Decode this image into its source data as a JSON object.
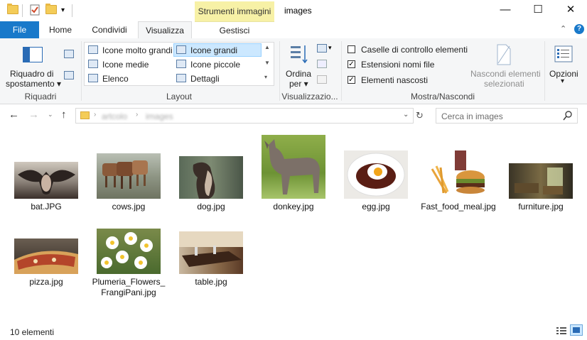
{
  "window": {
    "title": "images",
    "context_tab_group": "Strumenti immagini",
    "controls": {
      "minimize": "—",
      "maximize": "☐",
      "close": "✕"
    }
  },
  "tabs": {
    "file": "File",
    "home": "Home",
    "share": "Condividi",
    "view": "Visualizza",
    "manage": "Gestisci"
  },
  "ribbon": {
    "panes": {
      "nav_pane_line1": "Riquadro di",
      "nav_pane_line2": "spostamento ▾",
      "group_label": "Riquadri"
    },
    "layout": {
      "items": [
        "Icone molto grandi",
        "Icone grandi",
        "Icone medie",
        "Icone piccole",
        "Elenco",
        "Dettagli"
      ],
      "selected": "Icone grandi",
      "group_label": "Layout"
    },
    "current_view": {
      "sort_line1": "Ordina",
      "sort_line2": "per ▾",
      "group_label": "Visualizzazio..."
    },
    "show_hide": {
      "item_checkboxes": {
        "label": "Caselle di controllo elementi",
        "checked": false
      },
      "file_extensions": {
        "label": "Estensioni nomi file",
        "checked": true
      },
      "hidden_items": {
        "label": "Elementi nascosti",
        "checked": true
      },
      "hide_selected_line1": "Nascondi elementi",
      "hide_selected_line2": "selezionati",
      "group_label": "Mostra/Nascondi"
    },
    "options": {
      "line1": "Opzioni",
      "line2": "▾"
    }
  },
  "address": {
    "path_segments": [
      "artcolo",
      "images"
    ],
    "search_placeholder": "Cerca in images"
  },
  "files": [
    {
      "name": "bat.JPG"
    },
    {
      "name": "cows.jpg"
    },
    {
      "name": "dog.jpg"
    },
    {
      "name": "donkey.jpg"
    },
    {
      "name": "egg.jpg"
    },
    {
      "name": "Fast_food_meal.jpg"
    },
    {
      "name": "furniture.jpg"
    },
    {
      "name": "pizza.jpg"
    },
    {
      "name": "Plumeria_Flowers_FrangiPani.jpg"
    },
    {
      "name": "table.jpg"
    }
  ],
  "status": {
    "count": "10 elementi"
  },
  "colors": {
    "file_tab": "#1979ca",
    "context_tab": "#f7f1a6",
    "selection": "#cce8ff"
  }
}
